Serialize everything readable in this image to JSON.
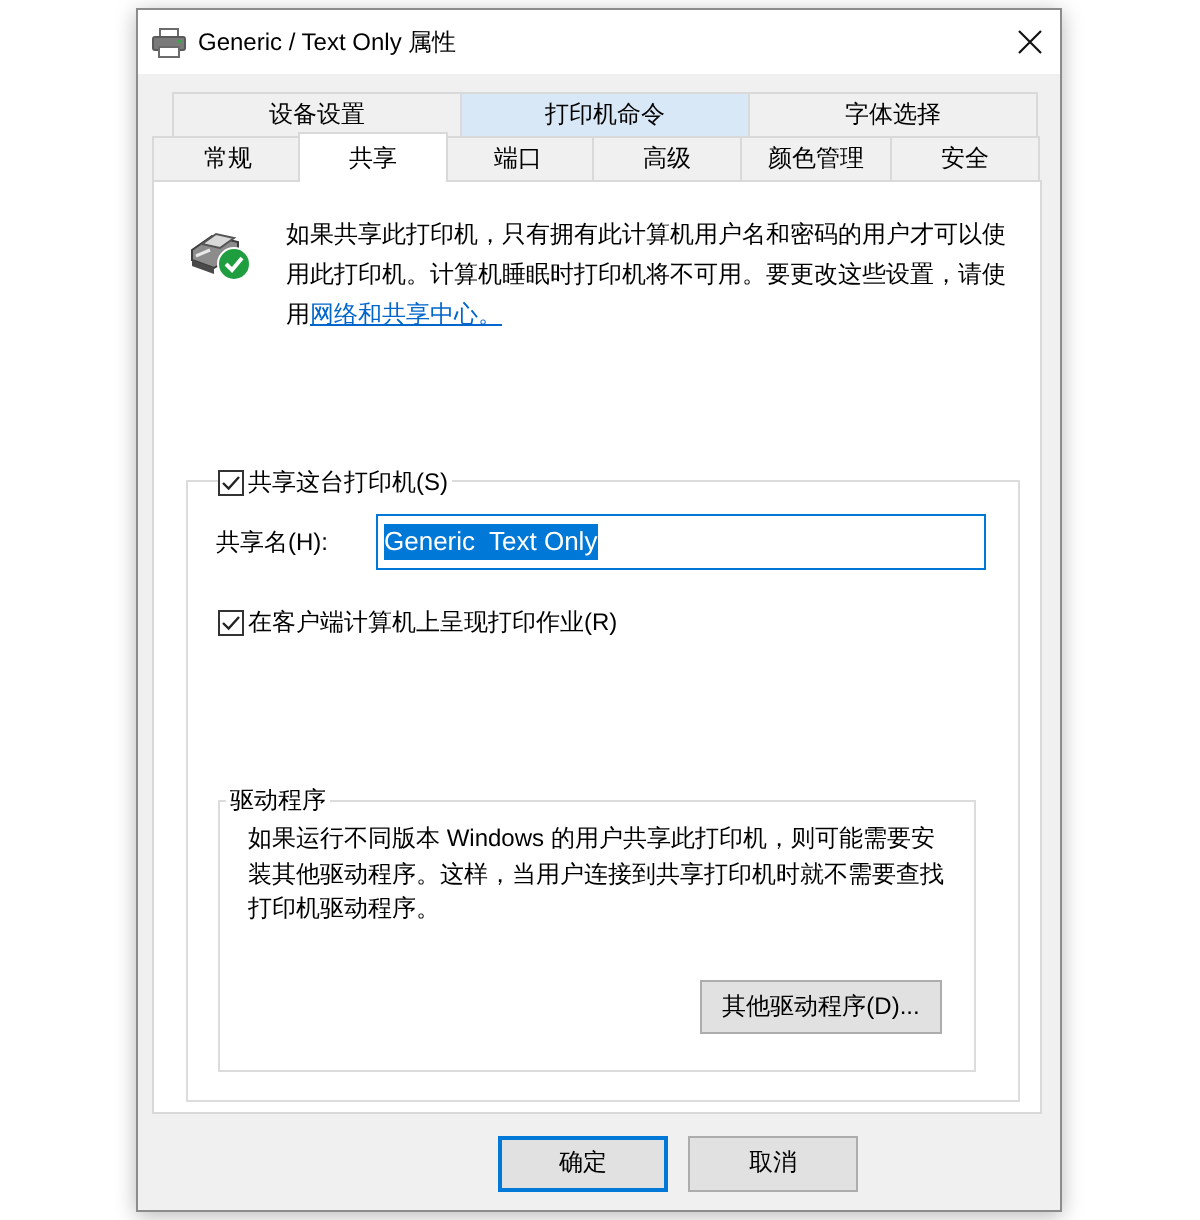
{
  "window": {
    "title": "Generic / Text Only 属性"
  },
  "tab_rows": [
    [
      {
        "label": "设备设置",
        "selected": false,
        "hovered": false
      },
      {
        "label": "打印机命令",
        "selected": false,
        "hovered": true
      },
      {
        "label": "字体选择",
        "selected": false,
        "hovered": false
      }
    ],
    [
      {
        "label": "常规",
        "selected": false,
        "hovered": false
      },
      {
        "label": "共享",
        "selected": true,
        "hovered": false
      },
      {
        "label": "端口",
        "selected": false,
        "hovered": false
      },
      {
        "label": "高级",
        "selected": false,
        "hovered": false
      },
      {
        "label": "颜色管理",
        "selected": false,
        "hovered": false
      },
      {
        "label": "安全",
        "selected": false,
        "hovered": false
      }
    ]
  ],
  "intro": {
    "text": "如果共享此打印机，只有拥有此计算机用户名和密码的用户才可以使用此打印机。计算机睡眠时打印机将不可用。要更改这些设置，请使用",
    "link": "网络和共享中心。"
  },
  "share_group": {
    "share_checkbox": {
      "label": "共享这台打印机(S)",
      "checked": true
    },
    "share_name": {
      "label": "共享名(H):",
      "value": "Generic  Text Only",
      "value_selected": true
    },
    "render_checkbox": {
      "label": "在客户端计算机上呈现打印作业(R)",
      "checked": true
    },
    "drivers": {
      "title": "驱动程序",
      "text": "如果运行不同版本 Windows 的用户共享此打印机，则可能需要安装其他驱动程序。这样，当用户连接到共享打印机时就不需要查找打印机驱动程序。",
      "button": "其他驱动程序(D)..."
    }
  },
  "buttons": [
    {
      "label": "确定",
      "default": true
    },
    {
      "label": "取消",
      "default": false
    }
  ]
}
